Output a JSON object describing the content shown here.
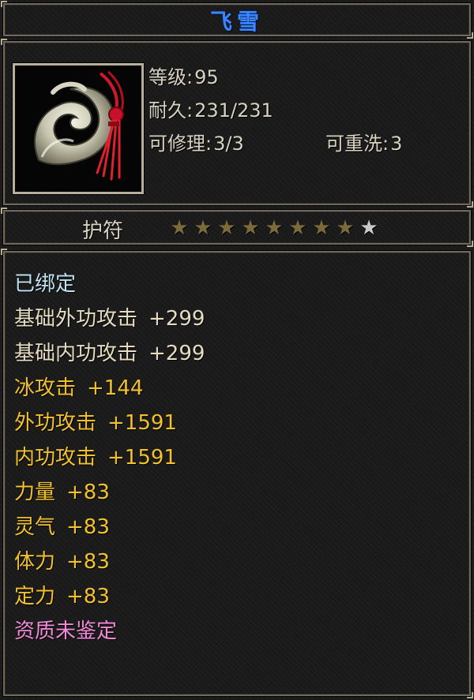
{
  "item": {
    "name": "飞雪",
    "icon": "jade-amulet-icon",
    "level_label": "等级:",
    "level_value": "95",
    "durability_label": "耐久:",
    "durability_value": "231/231",
    "repairable_label": "可修理:",
    "repairable_value": "3/3",
    "rewash_label": "可重洗:",
    "rewash_value": "3",
    "type": "护符",
    "stars": {
      "total": 9,
      "filled": 8
    }
  },
  "attributes": [
    {
      "name": "已绑定",
      "value": "",
      "color": "#bfe3f0"
    },
    {
      "name": "基础外功攻击",
      "value": "+299",
      "color": "#e6dcc0"
    },
    {
      "name": "基础内功攻击",
      "value": "+299",
      "color": "#e6dcc0"
    },
    {
      "name": "冰攻击",
      "value": "+144",
      "color": "#f2c12e"
    },
    {
      "name": "外功攻击",
      "value": "+1591",
      "color": "#f2c12e"
    },
    {
      "name": "内功攻击",
      "value": "+1591",
      "color": "#f2c12e"
    },
    {
      "name": "力量",
      "value": "+83",
      "color": "#f2c12e"
    },
    {
      "name": "灵气",
      "value": "+83",
      "color": "#f2c12e"
    },
    {
      "name": "体力",
      "value": "+83",
      "color": "#f2c12e"
    },
    {
      "name": "定力",
      "value": "+83",
      "color": "#f2c12e"
    },
    {
      "name": "资质未鉴定",
      "value": "",
      "color": "#f08ad6"
    }
  ],
  "colors": {
    "title": "#3a86ff",
    "star_filled": "#7b6a3a",
    "star_empty": "#c9c9c9"
  }
}
